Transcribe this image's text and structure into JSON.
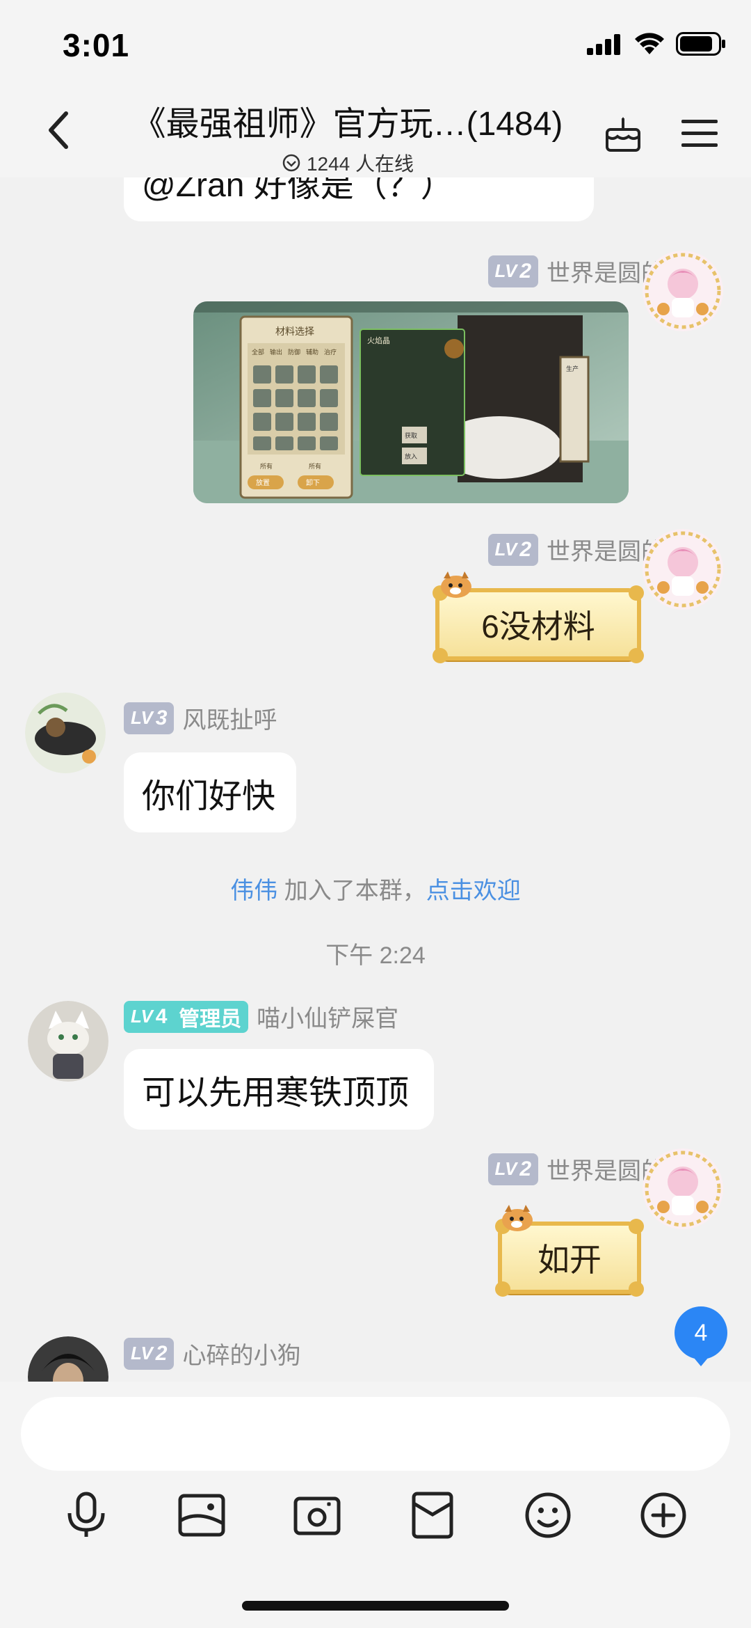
{
  "status_bar": {
    "time": "3:01"
  },
  "header": {
    "title": "《最强祖师》官方玩…(1484)",
    "online_text": "1244 人在线"
  },
  "messages": {
    "partial_top": {
      "text": "@Zran 好像是（？）"
    },
    "msg1": {
      "level": "2",
      "sender": "世界是圆的",
      "type": "image"
    },
    "game_image": {
      "panel_title": "材料选择",
      "tabs": [
        "全部",
        "输出",
        "防御",
        "辅助",
        "治疗"
      ],
      "item_name": "火焰晶",
      "btn_get": "获取",
      "btn_put": "放入",
      "btn_a": "放置",
      "btn_b": "卸下",
      "side_label": "生产",
      "sel_a": "所有",
      "sel_b": "所有"
    },
    "msg2": {
      "level": "2",
      "sender": "世界是圆的",
      "sticker_text": "6没材料"
    },
    "msg3": {
      "level": "3",
      "sender": "风既扯呼",
      "text": "你们好快"
    },
    "join_notice": {
      "name": "伟伟",
      "middle": " 加入了本群，",
      "action": "点击欢迎"
    },
    "timestamp": "下午 2:24",
    "msg4": {
      "level": "4",
      "role": "管理员",
      "sender": "喵小仙铲屎官",
      "text": "可以先用寒铁顶顶"
    },
    "msg5": {
      "level": "2",
      "sender": "世界是圆的",
      "sticker_text": "如开"
    },
    "msg6": {
      "level": "2",
      "sender": "心碎的小狗"
    }
  },
  "lv_prefix": "LV",
  "unread_count": "4",
  "input": {
    "placeholder": ""
  },
  "toolbar_icons": [
    "microphone-icon",
    "image-icon",
    "camera-icon",
    "red-packet-icon",
    "emoji-icon",
    "plus-icon"
  ],
  "colors": {
    "link": "#4a90e2",
    "level_badge": "#b4b9cb",
    "admin_badge": "#5dd3cf",
    "unread": "#2b86f5"
  }
}
